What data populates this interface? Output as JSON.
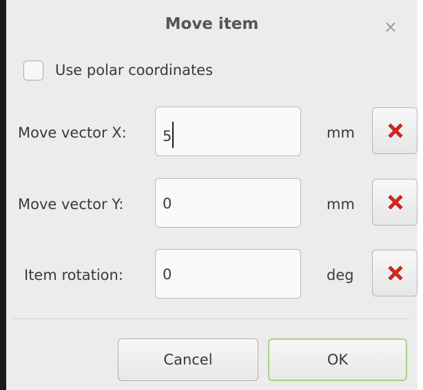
{
  "dialog": {
    "title": "Move item",
    "close_glyph": "×",
    "polar_label": "Use polar coordinates",
    "polar_checked": false
  },
  "fields": [
    {
      "label": "Move vector X:",
      "value": "5",
      "unit": "mm",
      "clear_icon": "red-x-icon"
    },
    {
      "label": "Move vector Y:",
      "value": "0",
      "unit": "mm",
      "clear_icon": "red-x-icon"
    },
    {
      "label": "Item rotation:",
      "value": "0",
      "unit": "deg",
      "clear_icon": "red-x-icon"
    }
  ],
  "buttons": {
    "cancel": "Cancel",
    "ok": "OK"
  },
  "colors": {
    "clear_icon": "#d9251d",
    "ok_focus_border": "#a9cf83"
  }
}
